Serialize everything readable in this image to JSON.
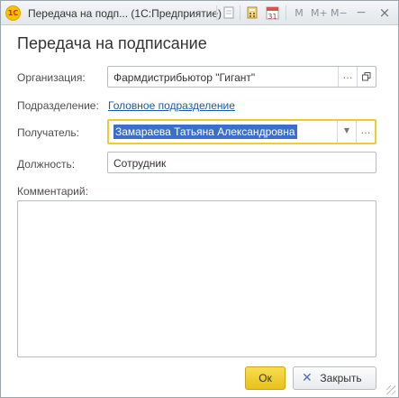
{
  "window": {
    "title": "Передача на подп...  (1С:Предприятие)",
    "logo_text": "1С",
    "toolbar_icons": [
      "document-icon",
      "calculator-icon",
      "calendar-icon"
    ],
    "calendar_day": "31",
    "buttons": {
      "m": "M",
      "m_plus": "M+",
      "m_minus": "M−",
      "minimize": "−",
      "close": "×"
    }
  },
  "form": {
    "title": "Передача на подписание",
    "organization": {
      "label": "Организация:",
      "value": "Фармдистрибьютор \"Гигант\""
    },
    "department": {
      "label": "Подразделение:",
      "value": "Головное подразделение"
    },
    "recipient": {
      "label": "Получатель:",
      "value": "Замараева Татьяна Александровна"
    },
    "position": {
      "label": "Должность:",
      "value": "Сотрудник"
    },
    "comment": {
      "label": "Комментарий:",
      "value": ""
    }
  },
  "actions": {
    "ok_label": "Ок",
    "close_label": "Закрыть"
  },
  "colors": {
    "accent_yellow": "#f0c935",
    "selection_blue": "#3b6fc9",
    "link_blue": "#1b5aa8"
  }
}
